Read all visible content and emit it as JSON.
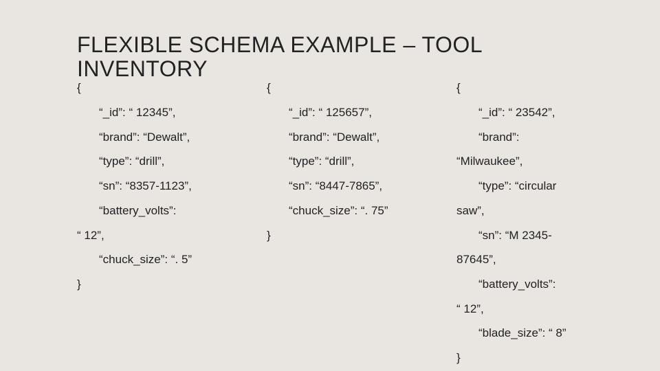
{
  "title": "FLEXIBLE SCHEMA EXAMPLE – TOOL INVENTORY",
  "col1": {
    "open": "{",
    "l1": "“_id”:  “ 12345”,",
    "l2": "“brand”:  “Dewalt”,",
    "l3": "“type”:  “drill”,",
    "l4": "“sn”:  “8357-1123”,",
    "l5a": "“battery_volts”:",
    "l5b": "“ 12”,",
    "l6": "“chuck_size”:  “. 5”",
    "close": "}"
  },
  "col2": {
    "open": "{",
    "l1": "“_id”:  “ 125657”,",
    "l2": "“brand”:  “Dewalt”,",
    "l3": "“type”:  “drill”,",
    "l4": "“sn”:  “8447-7865”,",
    "l5": "“chuck_size”:  “. 75”",
    "close": "}"
  },
  "col3": {
    "open": "{",
    "l1": "“_id”:  “ 23542”,",
    "l2a": "“brand”:",
    "l2b": "“Milwaukee”,",
    "l3a": "“type”:  “circular",
    "l3b": "saw”,",
    "l4a": "“sn”:  “M 2345-",
    "l4b": "87645”,",
    "l5a": "“battery_volts”:",
    "l5b": "“ 12”,",
    "l6": "“blade_size”:  “ 8”",
    "close": "}"
  }
}
